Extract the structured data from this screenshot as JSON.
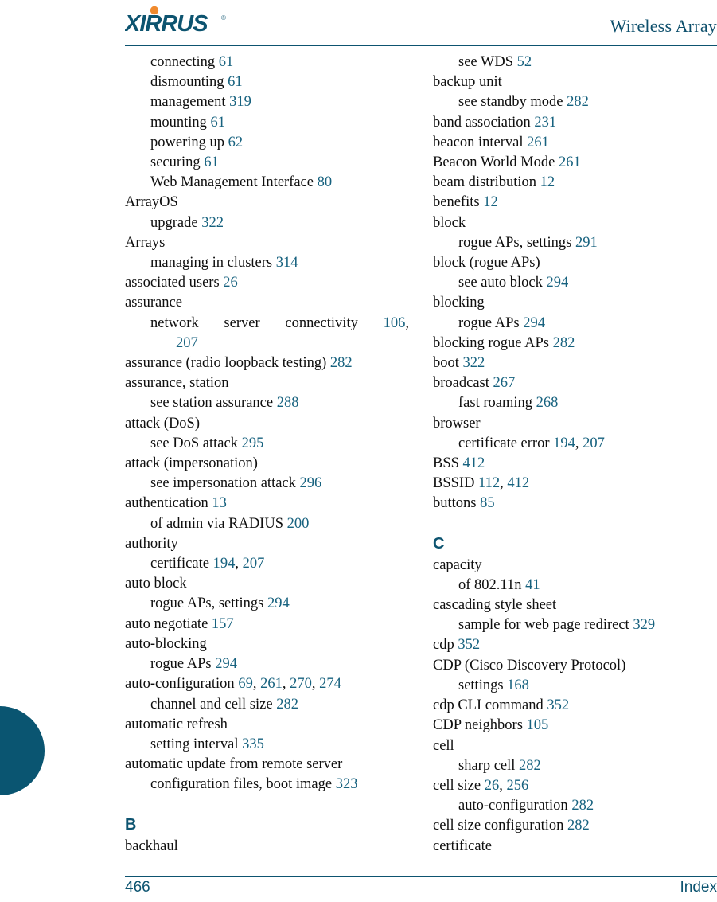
{
  "header": {
    "logo_text": "XIRRUS",
    "logo_mark": "®",
    "title": "Wireless Array"
  },
  "footer": {
    "page_number": "466",
    "section_label": "Index"
  },
  "columns": [
    {
      "name": "left-column",
      "entries": [
        {
          "level": 1,
          "text": "connecting",
          "pages": [
            "61"
          ]
        },
        {
          "level": 1,
          "text": "dismounting",
          "pages": [
            "61"
          ]
        },
        {
          "level": 1,
          "text": "management",
          "pages": [
            "319"
          ]
        },
        {
          "level": 1,
          "text": "mounting",
          "pages": [
            "61"
          ]
        },
        {
          "level": 1,
          "text": "powering up",
          "pages": [
            "62"
          ]
        },
        {
          "level": 1,
          "text": "securing",
          "pages": [
            "61"
          ]
        },
        {
          "level": 1,
          "text": "Web Management Interface",
          "pages": [
            "80"
          ]
        },
        {
          "level": 0,
          "text": "ArrayOS",
          "pages": []
        },
        {
          "level": 1,
          "text": "upgrade",
          "pages": [
            "322"
          ]
        },
        {
          "level": 0,
          "text": "Arrays",
          "pages": []
        },
        {
          "level": 1,
          "text": "managing in clusters",
          "pages": [
            "314"
          ]
        },
        {
          "level": 0,
          "text": "associated users",
          "pages": [
            "26"
          ]
        },
        {
          "level": 0,
          "text": "assurance",
          "pages": []
        },
        {
          "level": 1,
          "text": "network server connectivity",
          "pages": [
            "106"
          ],
          "justified": true
        },
        {
          "level": 2,
          "text": "",
          "pages": [
            "207"
          ]
        },
        {
          "level": 0,
          "text": "assurance (radio loopback testing)",
          "pages": [
            "282"
          ]
        },
        {
          "level": 0,
          "text": "assurance, station",
          "pages": []
        },
        {
          "level": 1,
          "text": "see station assurance",
          "pages": [
            "288"
          ]
        },
        {
          "level": 0,
          "text": "attack (DoS)",
          "pages": []
        },
        {
          "level": 1,
          "text": "see DoS attack",
          "pages": [
            "295"
          ]
        },
        {
          "level": 0,
          "text": "attack (impersonation)",
          "pages": []
        },
        {
          "level": 1,
          "text": "see impersonation attack",
          "pages": [
            "296"
          ]
        },
        {
          "level": 0,
          "text": "authentication",
          "pages": [
            "13"
          ]
        },
        {
          "level": 1,
          "text": "of admin via RADIUS",
          "pages": [
            "200"
          ]
        },
        {
          "level": 0,
          "text": "authority",
          "pages": []
        },
        {
          "level": 1,
          "text": "certificate",
          "pages": [
            "194",
            "207"
          ]
        },
        {
          "level": 0,
          "text": "auto block",
          "pages": []
        },
        {
          "level": 1,
          "text": "rogue APs, settings",
          "pages": [
            "294"
          ]
        },
        {
          "level": 0,
          "text": "auto negotiate",
          "pages": [
            "157"
          ]
        },
        {
          "level": 0,
          "text": "auto-blocking",
          "pages": []
        },
        {
          "level": 1,
          "text": "rogue APs",
          "pages": [
            "294"
          ]
        },
        {
          "level": 0,
          "text": "auto-configuration",
          "pages": [
            "69",
            "261",
            "270",
            "274"
          ]
        },
        {
          "level": 1,
          "text": "channel and cell size",
          "pages": [
            "282"
          ]
        },
        {
          "level": 0,
          "text": "automatic refresh",
          "pages": []
        },
        {
          "level": 1,
          "text": "setting interval",
          "pages": [
            "335"
          ]
        },
        {
          "level": 0,
          "text": "automatic update from remote server",
          "pages": []
        },
        {
          "level": 1,
          "text": "configuration files, boot image",
          "pages": [
            "323"
          ]
        },
        {
          "level": 0,
          "text": "B",
          "heading": true
        },
        {
          "level": 0,
          "text": "backhaul",
          "pages": []
        }
      ]
    },
    {
      "name": "right-column",
      "entries": [
        {
          "level": 1,
          "text": "see WDS",
          "pages": [
            "52"
          ]
        },
        {
          "level": 0,
          "text": "backup unit",
          "pages": []
        },
        {
          "level": 1,
          "text": "see standby mode",
          "pages": [
            "282"
          ]
        },
        {
          "level": 0,
          "text": "band association",
          "pages": [
            "231"
          ]
        },
        {
          "level": 0,
          "text": "beacon interval",
          "pages": [
            "261"
          ]
        },
        {
          "level": 0,
          "text": "Beacon World Mode",
          "pages": [
            "261"
          ]
        },
        {
          "level": 0,
          "text": "beam distribution",
          "pages": [
            "12"
          ]
        },
        {
          "level": 0,
          "text": "benefits",
          "pages": [
            "12"
          ]
        },
        {
          "level": 0,
          "text": "block",
          "pages": []
        },
        {
          "level": 1,
          "text": "rogue APs, settings",
          "pages": [
            "291"
          ]
        },
        {
          "level": 0,
          "text": "block (rogue APs)",
          "pages": []
        },
        {
          "level": 1,
          "text": "see auto block",
          "pages": [
            "294"
          ]
        },
        {
          "level": 0,
          "text": "blocking",
          "pages": []
        },
        {
          "level": 1,
          "text": "rogue APs",
          "pages": [
            "294"
          ]
        },
        {
          "level": 0,
          "text": "blocking rogue APs",
          "pages": [
            "282"
          ]
        },
        {
          "level": 0,
          "text": "boot",
          "pages": [
            "322"
          ]
        },
        {
          "level": 0,
          "text": "broadcast",
          "pages": [
            "267"
          ]
        },
        {
          "level": 1,
          "text": "fast roaming",
          "pages": [
            "268"
          ]
        },
        {
          "level": 0,
          "text": "browser",
          "pages": []
        },
        {
          "level": 1,
          "text": "certificate error",
          "pages": [
            "194",
            "207"
          ]
        },
        {
          "level": 0,
          "text": "BSS",
          "pages": [
            "412"
          ]
        },
        {
          "level": 0,
          "text": "BSSID",
          "pages": [
            "112",
            "412"
          ]
        },
        {
          "level": 0,
          "text": "buttons",
          "pages": [
            "85"
          ]
        },
        {
          "level": 0,
          "text": "C",
          "heading": true
        },
        {
          "level": 0,
          "text": "capacity",
          "pages": []
        },
        {
          "level": 1,
          "text": "of 802.11n",
          "pages": [
            "41"
          ]
        },
        {
          "level": 0,
          "text": "cascading style sheet",
          "pages": []
        },
        {
          "level": 1,
          "text": "sample for web page redirect",
          "pages": [
            "329"
          ]
        },
        {
          "level": 0,
          "text": "cdp",
          "pages": [
            "352"
          ]
        },
        {
          "level": 0,
          "text": "CDP (Cisco Discovery Protocol)",
          "pages": []
        },
        {
          "level": 1,
          "text": "settings",
          "pages": [
            "168"
          ]
        },
        {
          "level": 0,
          "text": "cdp CLI command",
          "pages": [
            "352"
          ]
        },
        {
          "level": 0,
          "text": "CDP neighbors",
          "pages": [
            "105"
          ]
        },
        {
          "level": 0,
          "text": "cell",
          "pages": []
        },
        {
          "level": 1,
          "text": "sharp cell",
          "pages": [
            "282"
          ]
        },
        {
          "level": 0,
          "text": "cell size",
          "pages": [
            "26",
            "256"
          ]
        },
        {
          "level": 1,
          "text": "auto-configuration",
          "pages": [
            "282"
          ]
        },
        {
          "level": 0,
          "text": "cell size configuration",
          "pages": [
            "282"
          ]
        },
        {
          "level": 0,
          "text": "certificate",
          "pages": []
        }
      ]
    }
  ],
  "colors": {
    "teal": "#0d5470",
    "page_number": "#17627f",
    "logo_accent": "#f08a2e",
    "body_text": "#0f0f0f"
  }
}
